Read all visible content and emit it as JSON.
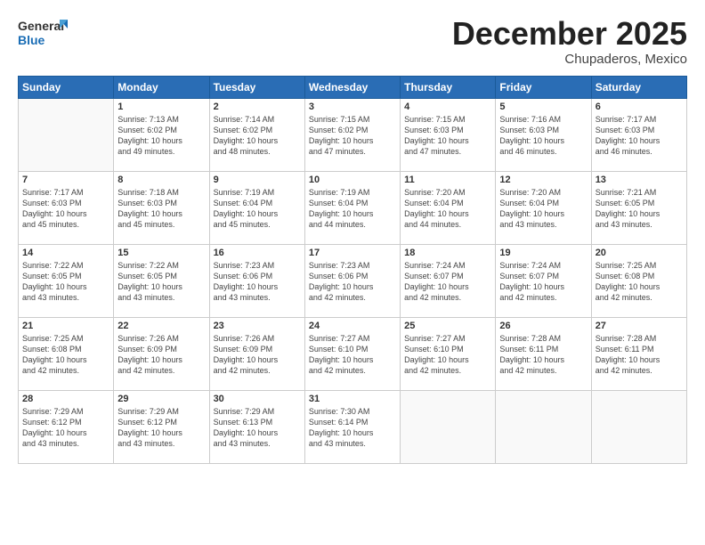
{
  "header": {
    "logo_line1": "General",
    "logo_line2": "Blue",
    "month": "December 2025",
    "location": "Chupaderos, Mexico"
  },
  "days_of_week": [
    "Sunday",
    "Monday",
    "Tuesday",
    "Wednesday",
    "Thursday",
    "Friday",
    "Saturday"
  ],
  "weeks": [
    [
      {
        "num": "",
        "info": ""
      },
      {
        "num": "1",
        "info": "Sunrise: 7:13 AM\nSunset: 6:02 PM\nDaylight: 10 hours\nand 49 minutes."
      },
      {
        "num": "2",
        "info": "Sunrise: 7:14 AM\nSunset: 6:02 PM\nDaylight: 10 hours\nand 48 minutes."
      },
      {
        "num": "3",
        "info": "Sunrise: 7:15 AM\nSunset: 6:02 PM\nDaylight: 10 hours\nand 47 minutes."
      },
      {
        "num": "4",
        "info": "Sunrise: 7:15 AM\nSunset: 6:03 PM\nDaylight: 10 hours\nand 47 minutes."
      },
      {
        "num": "5",
        "info": "Sunrise: 7:16 AM\nSunset: 6:03 PM\nDaylight: 10 hours\nand 46 minutes."
      },
      {
        "num": "6",
        "info": "Sunrise: 7:17 AM\nSunset: 6:03 PM\nDaylight: 10 hours\nand 46 minutes."
      }
    ],
    [
      {
        "num": "7",
        "info": "Sunrise: 7:17 AM\nSunset: 6:03 PM\nDaylight: 10 hours\nand 45 minutes."
      },
      {
        "num": "8",
        "info": "Sunrise: 7:18 AM\nSunset: 6:03 PM\nDaylight: 10 hours\nand 45 minutes."
      },
      {
        "num": "9",
        "info": "Sunrise: 7:19 AM\nSunset: 6:04 PM\nDaylight: 10 hours\nand 45 minutes."
      },
      {
        "num": "10",
        "info": "Sunrise: 7:19 AM\nSunset: 6:04 PM\nDaylight: 10 hours\nand 44 minutes."
      },
      {
        "num": "11",
        "info": "Sunrise: 7:20 AM\nSunset: 6:04 PM\nDaylight: 10 hours\nand 44 minutes."
      },
      {
        "num": "12",
        "info": "Sunrise: 7:20 AM\nSunset: 6:04 PM\nDaylight: 10 hours\nand 43 minutes."
      },
      {
        "num": "13",
        "info": "Sunrise: 7:21 AM\nSunset: 6:05 PM\nDaylight: 10 hours\nand 43 minutes."
      }
    ],
    [
      {
        "num": "14",
        "info": "Sunrise: 7:22 AM\nSunset: 6:05 PM\nDaylight: 10 hours\nand 43 minutes."
      },
      {
        "num": "15",
        "info": "Sunrise: 7:22 AM\nSunset: 6:05 PM\nDaylight: 10 hours\nand 43 minutes."
      },
      {
        "num": "16",
        "info": "Sunrise: 7:23 AM\nSunset: 6:06 PM\nDaylight: 10 hours\nand 43 minutes."
      },
      {
        "num": "17",
        "info": "Sunrise: 7:23 AM\nSunset: 6:06 PM\nDaylight: 10 hours\nand 42 minutes."
      },
      {
        "num": "18",
        "info": "Sunrise: 7:24 AM\nSunset: 6:07 PM\nDaylight: 10 hours\nand 42 minutes."
      },
      {
        "num": "19",
        "info": "Sunrise: 7:24 AM\nSunset: 6:07 PM\nDaylight: 10 hours\nand 42 minutes."
      },
      {
        "num": "20",
        "info": "Sunrise: 7:25 AM\nSunset: 6:08 PM\nDaylight: 10 hours\nand 42 minutes."
      }
    ],
    [
      {
        "num": "21",
        "info": "Sunrise: 7:25 AM\nSunset: 6:08 PM\nDaylight: 10 hours\nand 42 minutes."
      },
      {
        "num": "22",
        "info": "Sunrise: 7:26 AM\nSunset: 6:09 PM\nDaylight: 10 hours\nand 42 minutes."
      },
      {
        "num": "23",
        "info": "Sunrise: 7:26 AM\nSunset: 6:09 PM\nDaylight: 10 hours\nand 42 minutes."
      },
      {
        "num": "24",
        "info": "Sunrise: 7:27 AM\nSunset: 6:10 PM\nDaylight: 10 hours\nand 42 minutes."
      },
      {
        "num": "25",
        "info": "Sunrise: 7:27 AM\nSunset: 6:10 PM\nDaylight: 10 hours\nand 42 minutes."
      },
      {
        "num": "26",
        "info": "Sunrise: 7:28 AM\nSunset: 6:11 PM\nDaylight: 10 hours\nand 42 minutes."
      },
      {
        "num": "27",
        "info": "Sunrise: 7:28 AM\nSunset: 6:11 PM\nDaylight: 10 hours\nand 42 minutes."
      }
    ],
    [
      {
        "num": "28",
        "info": "Sunrise: 7:29 AM\nSunset: 6:12 PM\nDaylight: 10 hours\nand 43 minutes."
      },
      {
        "num": "29",
        "info": "Sunrise: 7:29 AM\nSunset: 6:12 PM\nDaylight: 10 hours\nand 43 minutes."
      },
      {
        "num": "30",
        "info": "Sunrise: 7:29 AM\nSunset: 6:13 PM\nDaylight: 10 hours\nand 43 minutes."
      },
      {
        "num": "31",
        "info": "Sunrise: 7:30 AM\nSunset: 6:14 PM\nDaylight: 10 hours\nand 43 minutes."
      },
      {
        "num": "",
        "info": ""
      },
      {
        "num": "",
        "info": ""
      },
      {
        "num": "",
        "info": ""
      }
    ]
  ]
}
